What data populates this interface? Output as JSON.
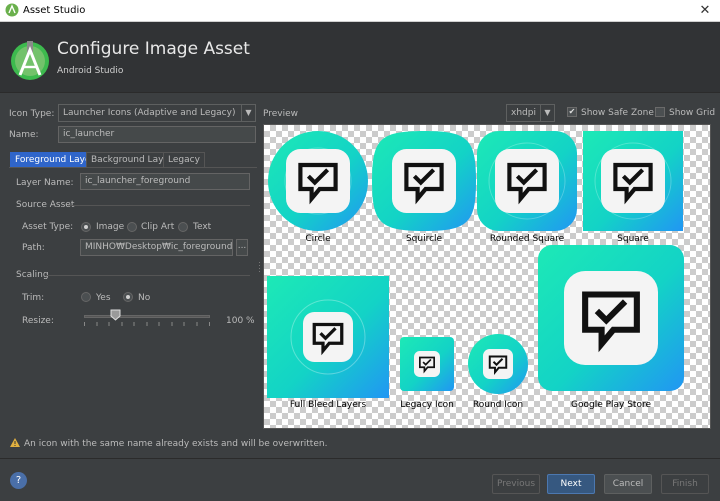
{
  "window": {
    "title": "Asset Studio",
    "close_glyph": "✕"
  },
  "header": {
    "title": "Configure Image Asset",
    "subtitle": "Android Studio"
  },
  "form": {
    "icon_type_label": "Icon Type:",
    "icon_type_value": "Launcher Icons (Adaptive and Legacy)",
    "name_label": "Name:",
    "name_value": "ic_launcher",
    "tabs": [
      "Foreground Layer",
      "Background Layer",
      "Legacy"
    ],
    "layer_name_label": "Layer Name:",
    "layer_name_value": "ic_launcher_foreground",
    "source_asset_section": "Source Asset",
    "asset_type_label": "Asset Type:",
    "asset_type_options": [
      "Image",
      "Clip Art",
      "Text"
    ],
    "asset_type_selected": "Image",
    "path_label": "Path:",
    "path_value": "MINHO₩Desktop₩ic_foreground.png",
    "browse_label": "...",
    "scaling_section": "Scaling",
    "trim_label": "Trim:",
    "trim_options": [
      "Yes",
      "No"
    ],
    "trim_selected": "No",
    "resize_label": "Resize:",
    "resize_value": "100 %"
  },
  "preview": {
    "label": "Preview",
    "density": "xhdpi",
    "show_safe_zone_label": "Show Safe Zone",
    "show_safe_zone_checked": true,
    "show_grid_label": "Show Grid",
    "show_grid_checked": false,
    "captions": [
      "Circle",
      "Squircle",
      "Rounded Square",
      "Square",
      "Full Bleed Layers",
      "Legacy Icon",
      "Round Icon",
      "Google Play Store"
    ]
  },
  "warning": "An icon with the same name already exists and will be overwritten.",
  "footer": {
    "help": "?",
    "previous": "Previous",
    "next": "Next",
    "cancel": "Cancel",
    "finish": "Finish"
  },
  "colors": {
    "accent": "#2f65ca",
    "gradient_start": "#1de9b6",
    "gradient_end": "#2196f3"
  }
}
